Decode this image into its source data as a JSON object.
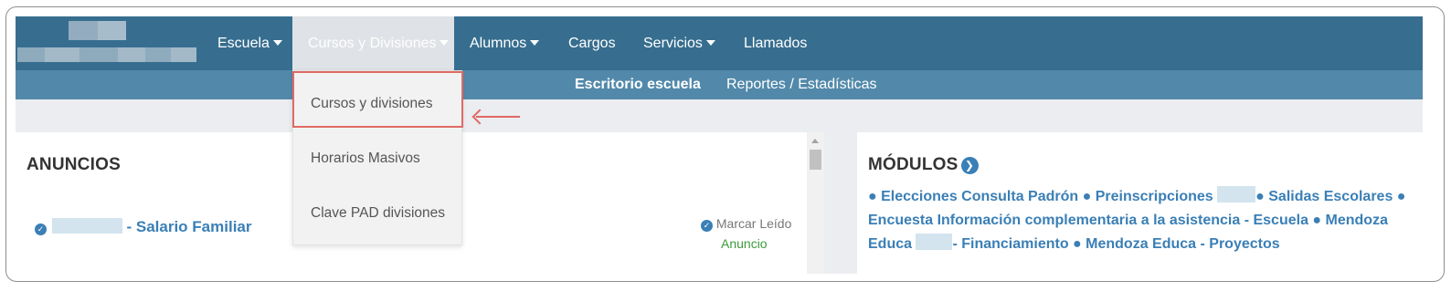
{
  "nav": {
    "items": [
      {
        "label": "Escuela",
        "has_caret": true
      },
      {
        "label": "Cursos y Divisiones",
        "has_caret": true
      },
      {
        "label": "Alumnos",
        "has_caret": true
      },
      {
        "label": "Cargos",
        "has_caret": false
      },
      {
        "label": "Servicios",
        "has_caret": true
      },
      {
        "label": "Llamados",
        "has_caret": false
      }
    ]
  },
  "subnav": {
    "items": [
      {
        "label": "Escritorio escuela"
      },
      {
        "label": "Reportes / Estadísticas"
      }
    ]
  },
  "dropdown": {
    "items": [
      {
        "label": "Cursos y divisiones"
      },
      {
        "label": "Horarios Masivos"
      },
      {
        "label": "Clave PAD divisiones"
      }
    ]
  },
  "anuncios": {
    "title": "ANUNCIOS",
    "items": [
      {
        "separator": "-",
        "title": "Salario Familiar",
        "action": "Marcar Leído",
        "type": "Anuncio"
      }
    ]
  },
  "modulos": {
    "title": "MÓDULOS",
    "links": [
      {
        "label": "Elecciones Consulta Padrón"
      },
      {
        "label": "Preinscripciones"
      },
      {
        "label": "Salidas Escolares"
      },
      {
        "label": "Encuesta Información complementaria a la asistencia - Escuela"
      },
      {
        "label": "Mendoza Educa"
      },
      {
        "label": "- Financiamiento"
      },
      {
        "label": "Mendoza Educa - Proyectos"
      }
    ]
  },
  "colors": {
    "topnav": "#376e8f",
    "subnav": "#5289aa",
    "link": "#3a7fb6",
    "highlight": "#e06a64",
    "anuncio_type": "#3c9b3c"
  },
  "icons": {
    "caret": "caret-down-icon",
    "check": "check-circle-icon",
    "arrow": "arrow-circle-right-icon"
  }
}
